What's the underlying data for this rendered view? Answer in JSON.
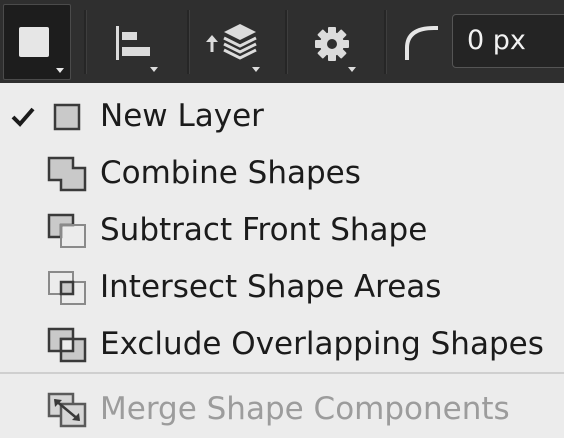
{
  "toolbar": {
    "buttons": [
      {
        "name": "shape-style-button",
        "icon": "square-fill-icon"
      },
      {
        "name": "align-button",
        "icon": "align-left-icon"
      },
      {
        "name": "arrange-layers-button",
        "icon": "layers-icon"
      },
      {
        "name": "settings-button",
        "icon": "gear-icon"
      }
    ],
    "corner_radius_icon": "corner-radius-icon",
    "corner_radius_value": "0 px"
  },
  "menu": {
    "items": [
      {
        "label": "New Layer",
        "icon": "new-layer-icon",
        "checked": true,
        "enabled": true
      },
      {
        "label": "Combine Shapes",
        "icon": "combine-shapes-icon",
        "checked": false,
        "enabled": true
      },
      {
        "label": "Subtract Front Shape",
        "icon": "subtract-front-shape-icon",
        "checked": false,
        "enabled": true
      },
      {
        "label": "Intersect Shape Areas",
        "icon": "intersect-shape-areas-icon",
        "checked": false,
        "enabled": true
      },
      {
        "label": "Exclude Overlapping Shapes",
        "icon": "exclude-overlapping-shapes-icon",
        "checked": false,
        "enabled": true
      },
      {
        "label": "Merge Shape Components",
        "icon": "merge-shape-components-icon",
        "checked": false,
        "enabled": false
      }
    ]
  },
  "colors": {
    "toolbar_bg": "#2f2f2f",
    "menu_bg": "#ececec",
    "text": "#1b1b1b",
    "disabled_text": "#9c9c9c"
  }
}
